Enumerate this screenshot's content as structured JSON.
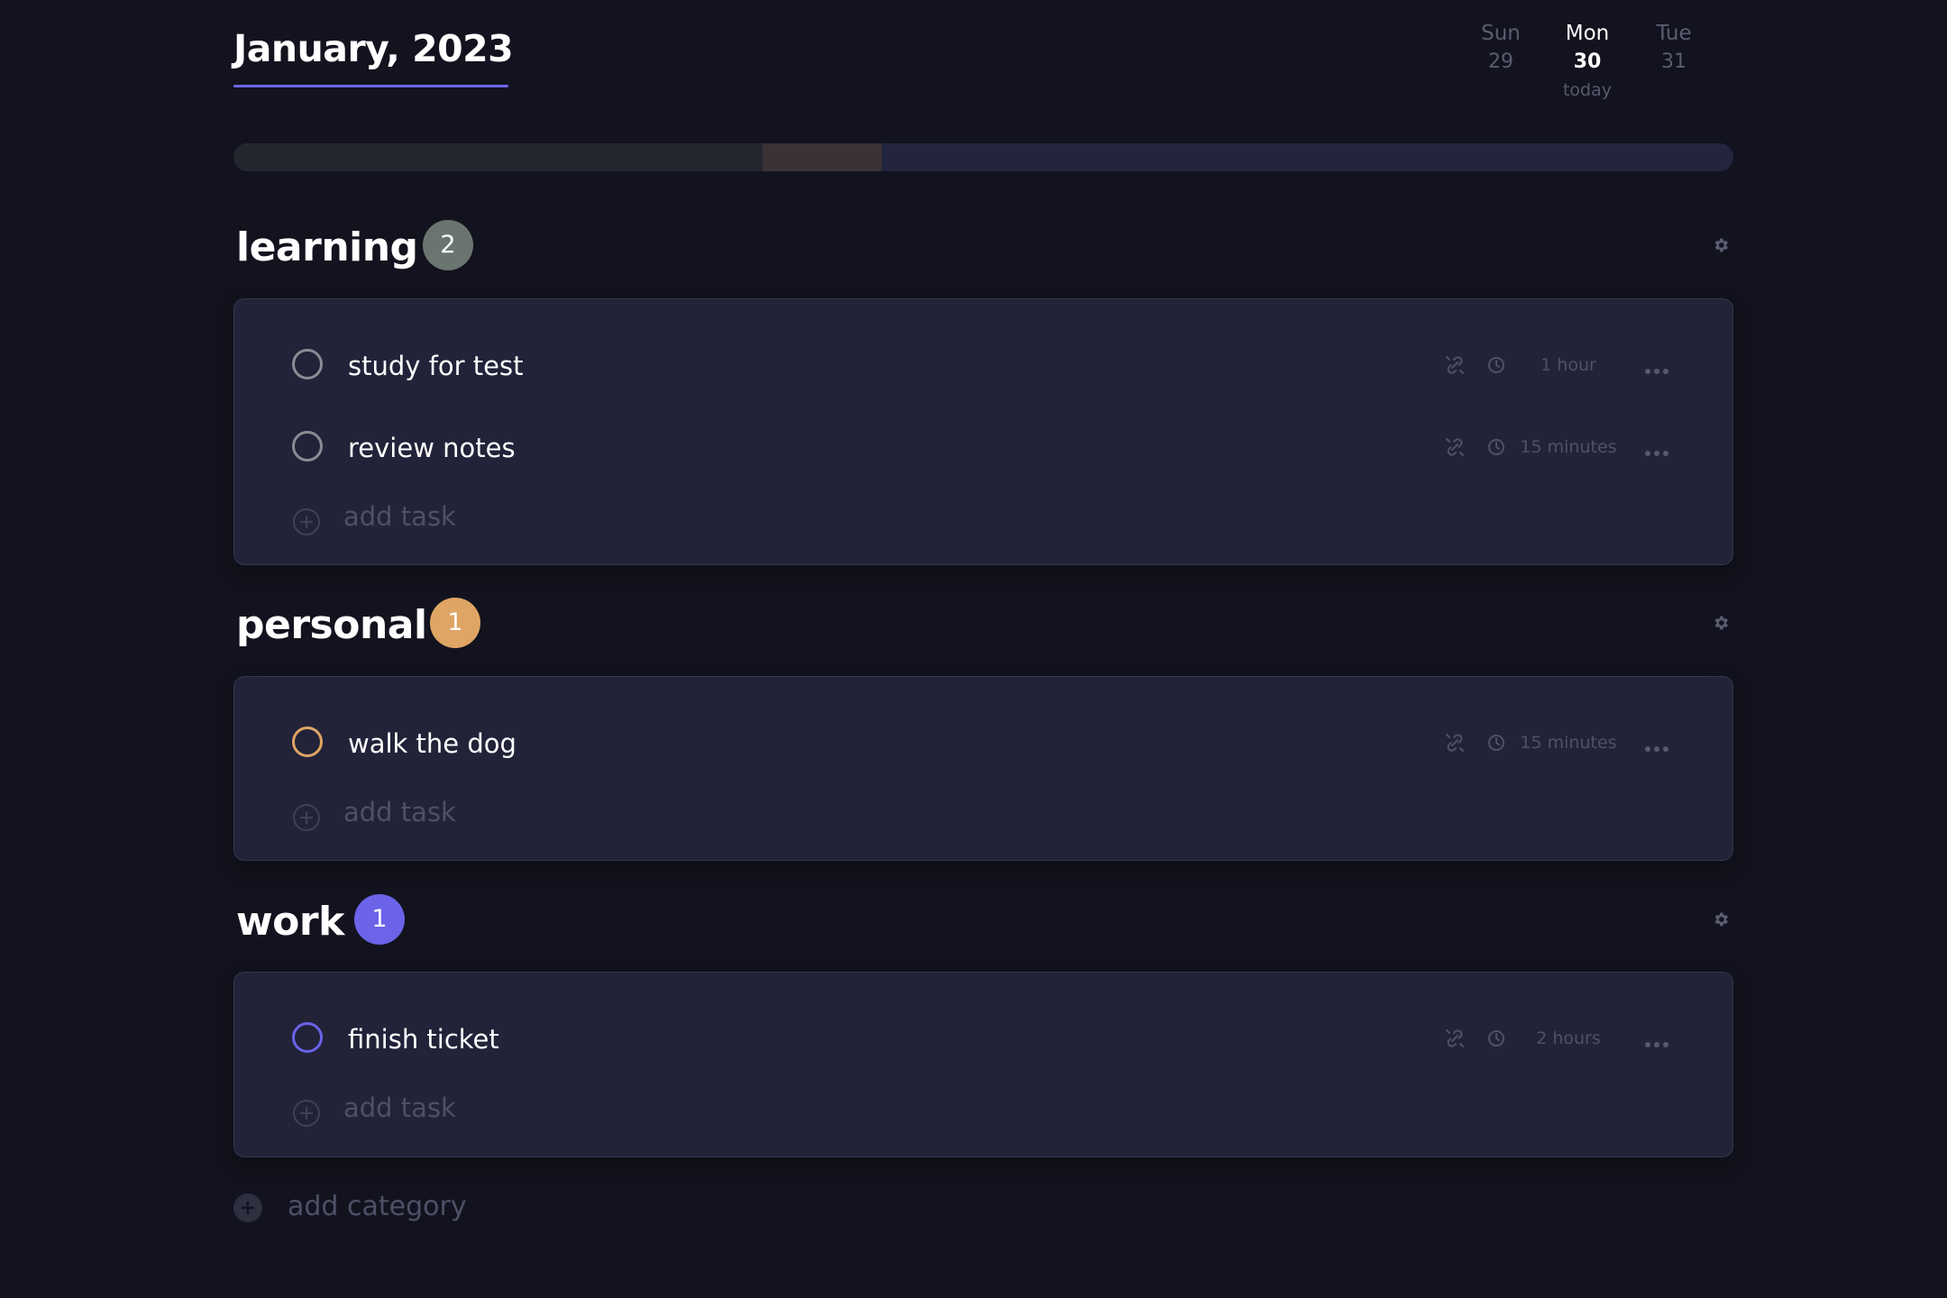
{
  "header": {
    "month_title": "January, 2023",
    "days": [
      {
        "name": "Sun",
        "num": "29",
        "sub": ""
      },
      {
        "name": "Mon",
        "num": "30",
        "sub": "today"
      },
      {
        "name": "Tue",
        "num": "31",
        "sub": ""
      }
    ]
  },
  "progress": {
    "segments": [
      {
        "color": "#24262f",
        "fraction": 0.353
      },
      {
        "color": "#3a3236",
        "fraction": 0.079
      },
      {
        "color": "#22253d",
        "fraction": 0.568
      }
    ]
  },
  "categories": [
    {
      "title": "learning",
      "count": "2",
      "color": "#6b7570",
      "circle_color": "#8b8b94",
      "tasks": [
        {
          "name": "study for test",
          "duration": "1 hour"
        },
        {
          "name": "review notes",
          "duration": "15 minutes"
        }
      ],
      "add_task_label": "add task"
    },
    {
      "title": "personal",
      "count": "1",
      "color": "#dfa564",
      "circle_color": "#dfa564",
      "tasks": [
        {
          "name": "walk the dog",
          "duration": "15 minutes"
        }
      ],
      "add_task_label": "add task"
    },
    {
      "title": "work",
      "count": "1",
      "color": "#6b63e8",
      "circle_color": "#6b63e8",
      "tasks": [
        {
          "name": "finish ticket",
          "duration": "2 hours"
        }
      ],
      "add_task_label": "add task"
    }
  ],
  "add_category_label": "add category",
  "icons": {
    "settings": "gear-icon",
    "link": "link-icon",
    "clock": "clock-icon",
    "more": "more-icon",
    "add": "plus-icon"
  }
}
